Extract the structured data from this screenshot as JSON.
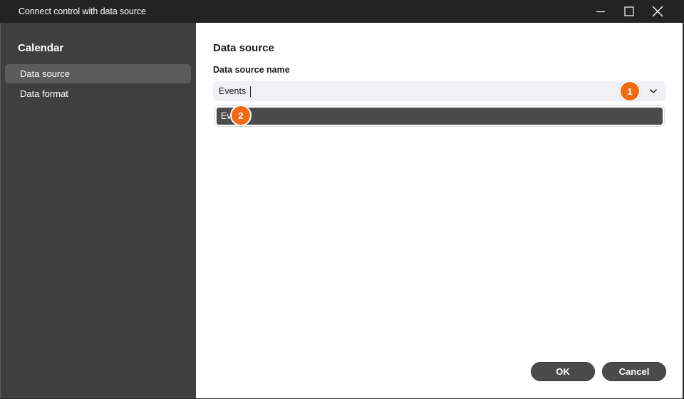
{
  "window": {
    "title": "Connect control with data source"
  },
  "sidebar": {
    "title": "Calendar",
    "items": [
      {
        "label": "Data source",
        "active": true
      },
      {
        "label": "Data format",
        "active": false
      }
    ]
  },
  "main": {
    "section_title": "Data source",
    "field_label": "Data source name",
    "combo_value": "Events",
    "dropdown_options": [
      "Ev"
    ]
  },
  "badges": {
    "first": "1",
    "second": "2"
  },
  "footer": {
    "ok_label": "OK",
    "cancel_label": "Cancel"
  },
  "colors": {
    "accent_badge": "#f26b12",
    "sidebar_bg": "#3f3f3f",
    "active_item_bg": "#5b5b5b",
    "button_bg": "#4b4b4b"
  },
  "icons": [
    "minimize-icon",
    "maximize-icon",
    "close-icon",
    "chevron-down-icon"
  ]
}
